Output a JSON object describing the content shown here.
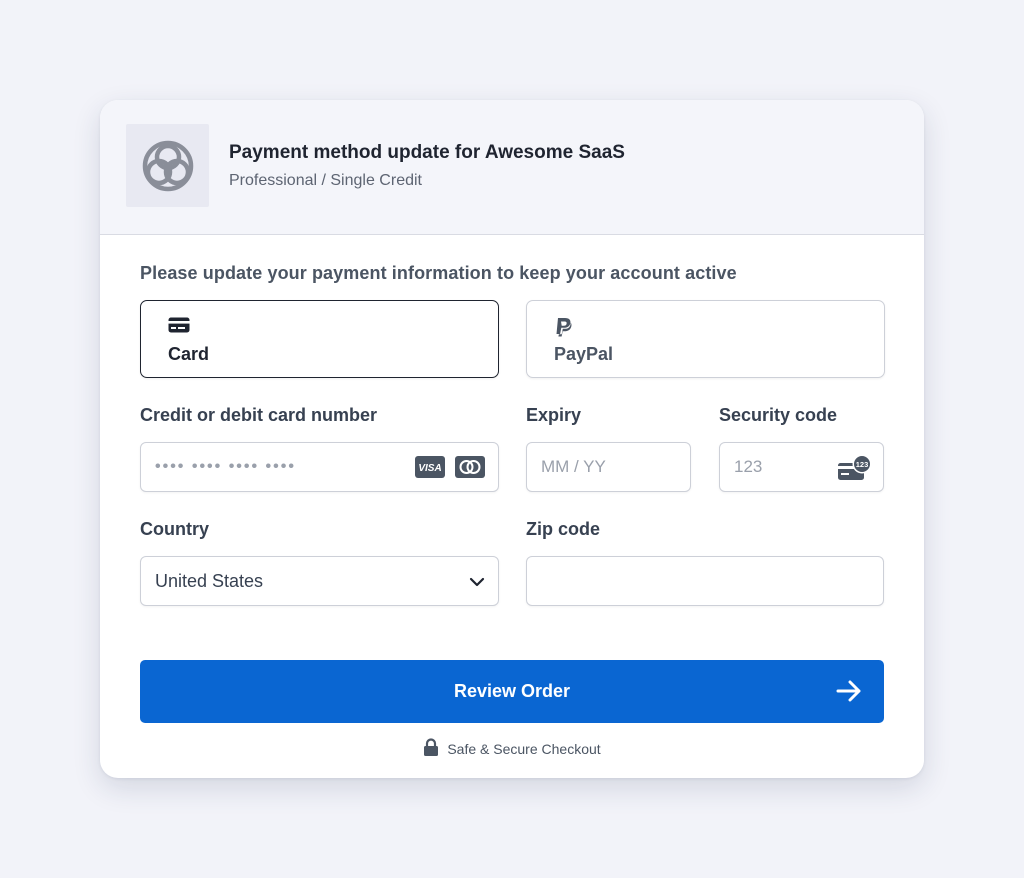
{
  "header": {
    "title": "Payment method update for Awesome SaaS",
    "subtitle": "Professional / Single Credit",
    "logo_icon": "trefoil-logo-icon"
  },
  "intro_text": "Please update your payment information to keep your account active",
  "payment_methods": [
    {
      "label": "Card",
      "icon": "credit-card-icon",
      "selected": true
    },
    {
      "label": "PayPal",
      "icon": "paypal-icon",
      "selected": false
    }
  ],
  "fields": {
    "card_number": {
      "label": "Credit or debit card number",
      "placeholder": "•••• •••• •••• ••••",
      "brands": [
        "VISA",
        "mastercard"
      ]
    },
    "expiry": {
      "label": "Expiry",
      "placeholder": "MM / YY"
    },
    "security_code": {
      "label": "Security code",
      "placeholder": "123",
      "badge": "123"
    },
    "country": {
      "label": "Country",
      "value": "United States"
    },
    "zip": {
      "label": "Zip code",
      "placeholder": ""
    }
  },
  "submit": {
    "label": "Review Order"
  },
  "secure_note": "Safe & Secure Checkout",
  "colors": {
    "primary": "#0a66d2",
    "background": "#f2f3f9",
    "header_bg": "#f4f5fa",
    "text_dark": "#1f2430"
  }
}
